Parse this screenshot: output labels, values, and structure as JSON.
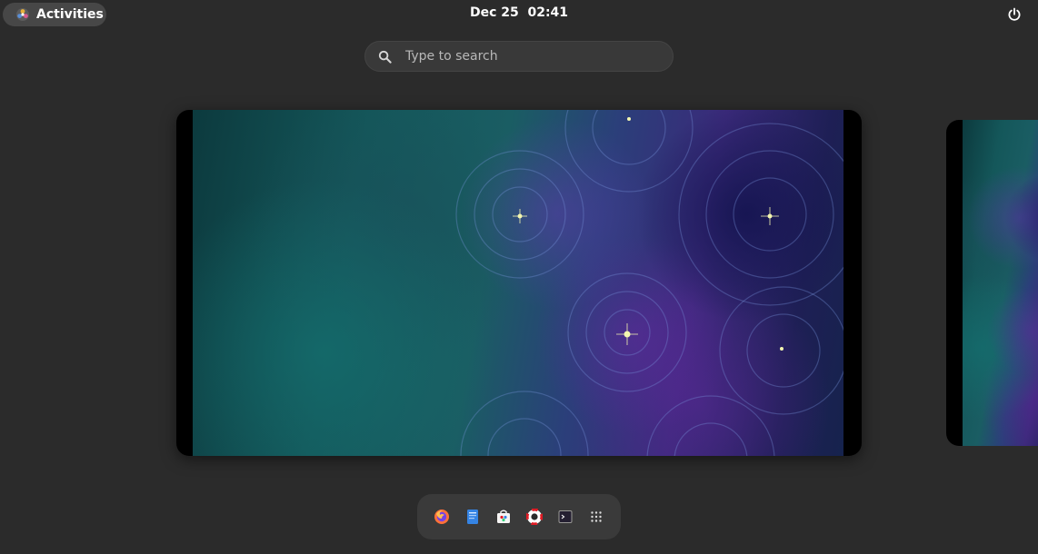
{
  "topbar": {
    "activities_label": "Activities",
    "clock": "Dec 25  02:41",
    "power_icon": "power-icon"
  },
  "search": {
    "placeholder": "Type to search",
    "icon": "search-icon"
  },
  "workspaces": [
    "current-workspace",
    "next-workspace"
  ],
  "dock": {
    "items": [
      {
        "name": "firefox",
        "icon": "firefox-icon"
      },
      {
        "name": "text-editor",
        "icon": "text-editor-icon"
      },
      {
        "name": "software",
        "icon": "software-icon"
      },
      {
        "name": "help",
        "icon": "help-icon"
      },
      {
        "name": "terminal",
        "icon": "terminal-icon"
      },
      {
        "name": "show-apps",
        "icon": "app-grid-icon"
      }
    ]
  },
  "colors": {
    "background": "#2b2b2b",
    "panel_button": "#474747",
    "search_bg": "#393939",
    "dock_bg": "#3a3a3a"
  }
}
